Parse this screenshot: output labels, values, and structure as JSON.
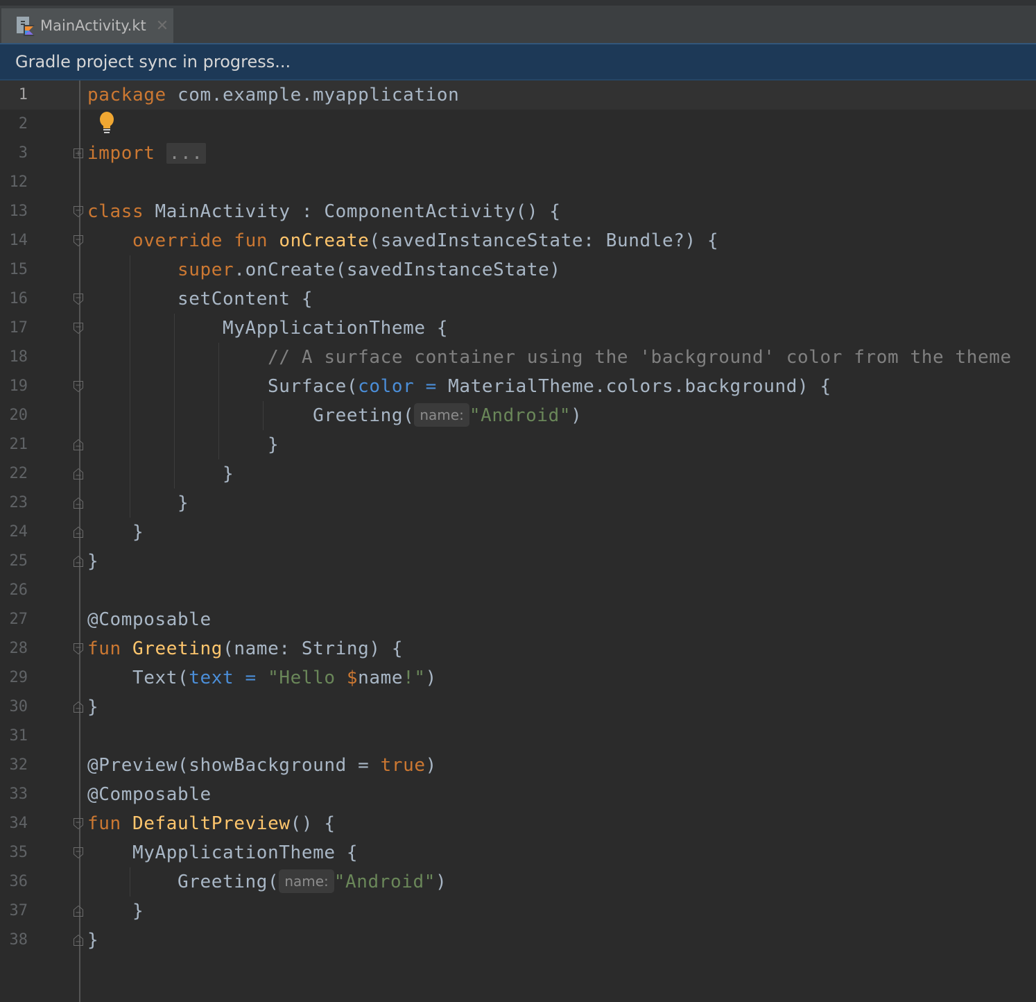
{
  "tab": {
    "label": "MainActivity.kt",
    "close": "✕",
    "icon": "kotlin-file-icon"
  },
  "banner": {
    "text": "Gradle project sync in progress..."
  },
  "colors": {
    "keyword": "#cc7832",
    "function": "#ffc66d",
    "string": "#6a8759",
    "comment": "#808080",
    "named_param": "#4b8ed8",
    "default_text": "#a9b7c6",
    "background": "#2b2b2b"
  },
  "gutter": {
    "line_numbers": [
      "1",
      "2",
      "3",
      "12",
      "13",
      "14",
      "15",
      "16",
      "17",
      "18",
      "19",
      "20",
      "21",
      "22",
      "23",
      "24",
      "25",
      "26",
      "27",
      "28",
      "29",
      "30",
      "31",
      "32",
      "33",
      "34",
      "35",
      "36",
      "37",
      "38"
    ]
  },
  "code": {
    "l1": {
      "kw": "package",
      "rest": " com.example.myapplication"
    },
    "l3": {
      "kw": "import",
      "folded": "..."
    },
    "l13": {
      "kw": "class",
      "rest": " MainActivity : ComponentActivity() {"
    },
    "l14": {
      "indent": "    ",
      "kw1": "override",
      "kw2": "fun",
      "fn": "onCreate",
      "rest": "(savedInstanceState: Bundle?) {"
    },
    "l15": {
      "indent": "        ",
      "kw": "super",
      "rest": ".onCreate(savedInstanceState)"
    },
    "l16": {
      "text": "        setContent {"
    },
    "l17": {
      "text": "            MyApplicationTheme {"
    },
    "l18": {
      "indent": "                ",
      "comment": "// A surface container using the 'background' color from the theme"
    },
    "l19": {
      "pre": "                Surface(",
      "param": "color",
      "eq": " = ",
      "rest": "MaterialTheme.colors.background) {"
    },
    "l20": {
      "pre": "                    Greeting(",
      "hint": "name:",
      "str": "\"Android\"",
      "close": ")"
    },
    "l21": {
      "text": "                }"
    },
    "l22": {
      "text": "            }"
    },
    "l23": {
      "text": "        }"
    },
    "l24": {
      "text": "    }"
    },
    "l25": {
      "text": "}"
    },
    "l27": {
      "text": "@Composable"
    },
    "l28": {
      "kw": "fun",
      "fn": "Greeting",
      "rest": "(name: String) {"
    },
    "l29": {
      "pre": "    Text(",
      "param": "text",
      "eq": " = ",
      "str1": "\"Hello ",
      "dollar": "$",
      "name": "name",
      "str2": "!\"",
      "close": ")"
    },
    "l30": {
      "text": "}"
    },
    "l32": {
      "pre": "@Preview(showBackground = ",
      "kw": "true",
      "close": ")"
    },
    "l33": {
      "text": "@Composable"
    },
    "l34": {
      "kw": "fun",
      "fn": "DefaultPreview",
      "rest": "() {"
    },
    "l35": {
      "text": "    MyApplicationTheme {"
    },
    "l36": {
      "pre": "        Greeting(",
      "hint": "name:",
      "str": "\"Android\"",
      "close": ")"
    },
    "l37": {
      "text": "    }"
    },
    "l38": {
      "text": "}"
    }
  }
}
